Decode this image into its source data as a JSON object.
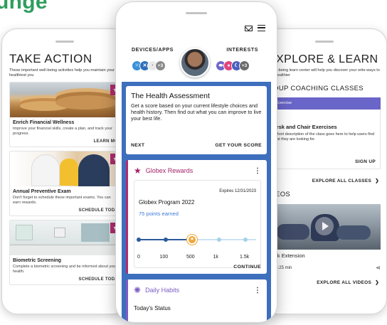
{
  "headline": "unge",
  "left": {
    "title": "TAKE ACTION",
    "subtitle": "These important well-being activities help you maintain your healthiest you",
    "cards": [
      {
        "title": "Enrich Financial Wellness",
        "desc": "Improve your financial skills, create a plan, and track your progress.",
        "link": "LEARN MO"
      },
      {
        "title": "Annual Preventive Exam",
        "desc": "Don't forget to schedule these important exams. You can earn rewards.",
        "link": "SCHEDULE TODA"
      },
      {
        "title": "Biometric Screening",
        "desc": "Complete a biometric screening and be informed about your health.",
        "link": "SCHEDULE TODA"
      }
    ]
  },
  "center": {
    "devices_label": "DEVICES/APPS",
    "interests_label": "INTERESTS",
    "devices_chips": [
      {
        "icon": "grid-icon",
        "glyph": "⁙",
        "color": "#3a8fd8"
      },
      {
        "icon": "activity-icon",
        "glyph": "✕",
        "color": "#2f6fb8"
      },
      {
        "icon": "talk-icon",
        "glyph": "·",
        "color": "#e9e9e9"
      },
      {
        "icon": "more-icon",
        "glyph": "+3",
        "color": "#8a8a8a"
      }
    ],
    "interests_chips": [
      {
        "icon": "shoe-icon",
        "glyph": "⬬",
        "color": "#7067c9"
      },
      {
        "icon": "apple-icon",
        "glyph": "●",
        "color": "#e0457b"
      },
      {
        "icon": "moon-icon",
        "glyph": "☾",
        "color": "#4b5fbf"
      },
      {
        "icon": "more-icon",
        "glyph": "+3",
        "color": "#6b6b6b"
      }
    ],
    "assessment": {
      "title": "The Health Assessment",
      "desc": "Get a score based on your current lifestyle choices and health history. Then find out what you can improve to live your best life.",
      "next": "NEXT",
      "score": "GET YOUR SCORE"
    },
    "rewards": {
      "title": "Globex Rewards",
      "expires": "Expires 12/31/2023",
      "program": "Globex Program 2022",
      "points": "75 points earned",
      "progress_points": 75,
      "ticks": [
        "0",
        "100",
        "500",
        "1k",
        "1.5k"
      ],
      "continue": "CONTINUE"
    },
    "habits": {
      "title": "Daily Habits",
      "status": "Today's Status"
    }
  },
  "right": {
    "title": "EXPLORE & LEARN",
    "subtitle": "r well-being learn center will help you discover your orite ways to live healthier",
    "classes_section": "ROUP COACHING CLASSES",
    "exercise_tag": "Exercise",
    "class_title": "Desk and Chair Exercises",
    "class_desc": "A short description of the class goes here to help users find what they are looking for.",
    "sign_up": "SIGN UP",
    "explore_classes": "EXPLORE ALL CLASSES",
    "videos_section": "IDEOS",
    "video_title": "Back Extension",
    "video_duration": "05:25 min",
    "explore_videos": "EXPLORE ALL VIDEOS"
  },
  "colors": {
    "brand_green": "#2f9e5e",
    "rewards_magenta": "#a3226a",
    "habits_purple": "#7c5cc3",
    "body_blue": "#3e6fbd",
    "exercise_purple": "#6a66c9",
    "progress_orange": "#f0a534"
  }
}
